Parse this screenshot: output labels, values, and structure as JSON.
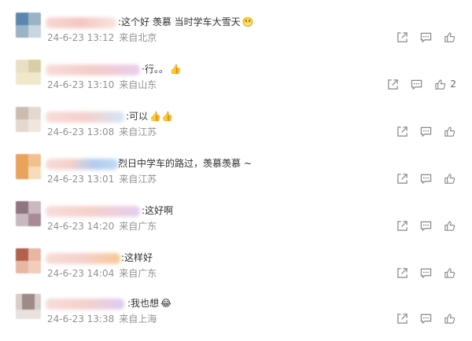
{
  "comments": [
    {
      "text": ":这个好 羡慕 当时学车大雪天",
      "emoji": "😬",
      "date": "24-6-23 13:12",
      "source": "来自北京",
      "likes": ""
    },
    {
      "text": "·行。。",
      "emoji": "👍",
      "date": "24-6-23 13:10",
      "source": "来自山东",
      "likes": "2"
    },
    {
      "text": ":可以",
      "emoji": "👍👍",
      "date": "24-6-23 13:08",
      "source": "来自江苏",
      "likes": ""
    },
    {
      "text": "烈日中学车的路过，羡慕羡慕 ~",
      "emoji": "",
      "date": "24-6-23 13:01",
      "source": "来自江苏",
      "likes": ""
    },
    {
      "text": ":这好啊",
      "emoji": "",
      "date": "24-6-23 14:20",
      "source": "来自广东",
      "likes": ""
    },
    {
      "text": ":这样好",
      "emoji": "",
      "date": "24-6-23 14:04",
      "source": "来自广东",
      "likes": ""
    },
    {
      "text": ":我也想",
      "emoji": "😂",
      "date": "24-6-23 13:38",
      "source": "来自上海",
      "likes": ""
    }
  ],
  "icons": {
    "share": "share-icon",
    "reply": "comment-icon",
    "like": "thumbs-up-icon"
  }
}
